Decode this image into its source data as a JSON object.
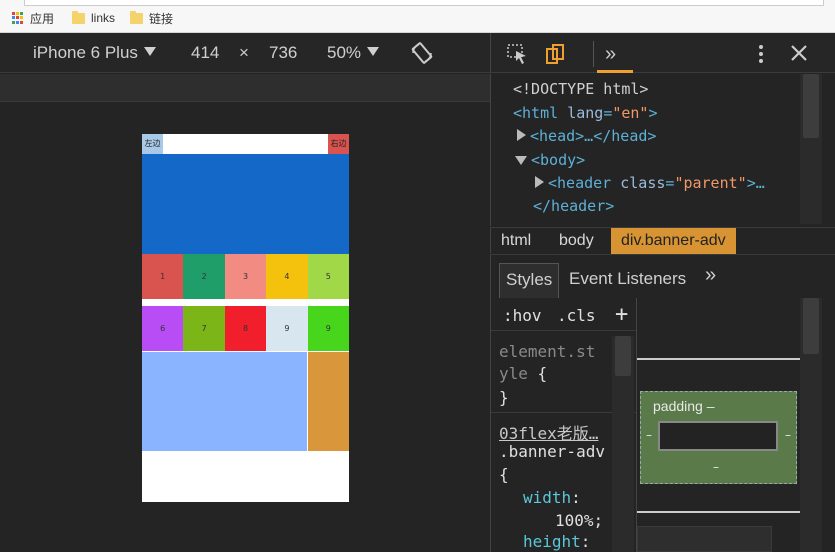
{
  "bookmarks": {
    "apps_label": "应用",
    "links_label": "links",
    "lianjie_label": "链接"
  },
  "device_toolbar": {
    "device": "iPhone 6 Plus",
    "width": "414",
    "times": "×",
    "height": "736",
    "zoom": "50%"
  },
  "phone": {
    "left_btn": "左边",
    "right_btn": "右边",
    "row1": [
      "1",
      "2",
      "3",
      "4",
      "5"
    ],
    "row2": [
      "6",
      "7",
      "8",
      "9",
      "9"
    ],
    "colors": {
      "row1": [
        "#d9534f",
        "#1f9e6a",
        "#f28b82",
        "#f4c20d",
        "#a0d848"
      ],
      "row2": [
        "#b84cf5",
        "#7cb518",
        "#f11e2b",
        "#d8e6ef",
        "#47d61b"
      ]
    }
  },
  "elements": {
    "doctype": "<!DOCTYPE html>",
    "html_open": "<html",
    "html_attr": "lang",
    "html_val": "\"en\"",
    "html_close": ">",
    "head": "<head>…</head>",
    "body": "<body>",
    "header_open": "<header",
    "header_attr": "class",
    "header_val": "\"parent\"",
    "header_close": ">…",
    "header_end": "</header>"
  },
  "breadcrumbs": [
    "html",
    "body",
    "div.banner-adv"
  ],
  "tabs": {
    "styles": "Styles",
    "event_listeners": "Event Listeners",
    "more": "»"
  },
  "styles_pane": {
    "hov": ":hov",
    "cls": ".cls",
    "plus": "+",
    "element_style_1": "element.st",
    "element_style_2": "yle",
    "open_brace": "{",
    "close_brace": "}",
    "source": "03flex老版…",
    "selector": ".banner-adv",
    "width_prop": "width",
    "width_val": "100%;",
    "height_prop": "height"
  },
  "box_model": {
    "padding_label": "padding",
    "dash": "–"
  }
}
